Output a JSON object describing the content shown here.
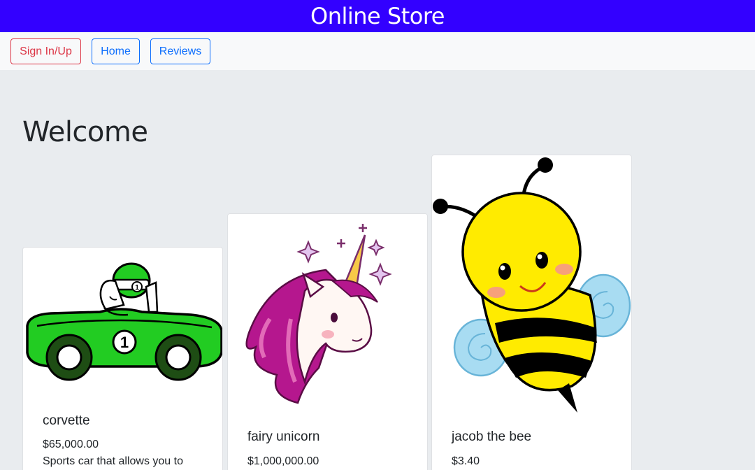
{
  "header": {
    "title": "Online Store",
    "color": "#3300ff"
  },
  "nav": {
    "signin_label": "Sign In/Up",
    "home_label": "Home",
    "reviews_label": "Reviews"
  },
  "main": {
    "heading": "Welcome",
    "products": [
      {
        "name": "corvette",
        "price": "$65,000.00",
        "description": "Sports car that allows you to",
        "image": "green-race-car"
      },
      {
        "name": "fairy unicorn",
        "price": "$1,000,000.00",
        "image": "unicorn-head"
      },
      {
        "name": "jacob the bee",
        "price": "$3.40",
        "image": "cartoon-bee"
      }
    ]
  }
}
